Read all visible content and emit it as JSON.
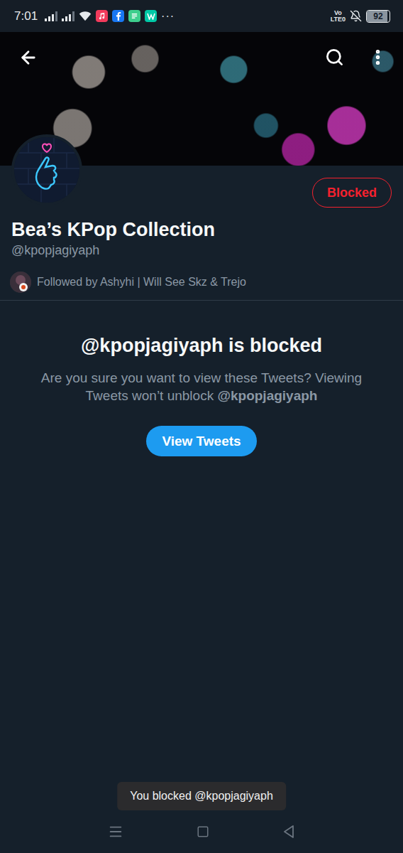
{
  "status_bar": {
    "time": "7:01",
    "overflow": "···",
    "volte": [
      "Vo",
      "LTE0"
    ],
    "battery": "92",
    "battery_level": 0.92
  },
  "profile": {
    "name": "Bea’s KPop Collection",
    "handle": "@kpopjagiyaph",
    "followed_by": "Followed by Ashyhi | Will See Skz & Trejo",
    "block_button": {
      "label": "Blocked",
      "blocked": true
    }
  },
  "blocked_notice": {
    "title": "@kpopjagiyaph is blocked",
    "message": "Are you sure you want to view these Tweets? Viewing Tweets won’t unblock ",
    "message_handle": "@kpopjagiyaph",
    "button": "View Tweets"
  },
  "toast": "You blocked @kpopjagiyaph"
}
